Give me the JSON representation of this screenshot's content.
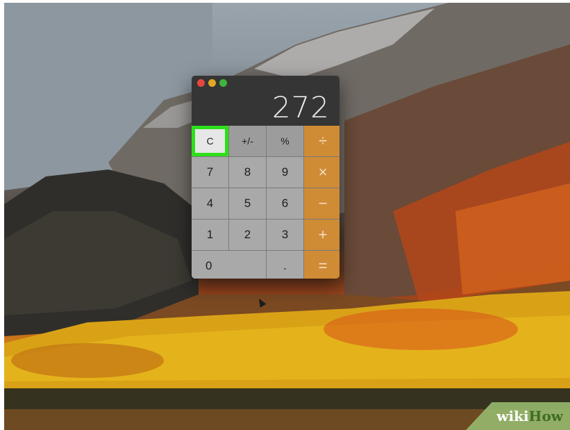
{
  "calculator": {
    "display_value": "272",
    "window_controls": [
      "close",
      "minimize",
      "zoom"
    ],
    "keys": [
      {
        "label": "C",
        "kind": "func",
        "selected": true
      },
      {
        "label": "+/-",
        "kind": "func"
      },
      {
        "label": "%",
        "kind": "func"
      },
      {
        "label": "÷",
        "kind": "op"
      },
      {
        "label": "7",
        "kind": "num"
      },
      {
        "label": "8",
        "kind": "num"
      },
      {
        "label": "9",
        "kind": "num"
      },
      {
        "label": "×",
        "kind": "op"
      },
      {
        "label": "4",
        "kind": "num"
      },
      {
        "label": "5",
        "kind": "num"
      },
      {
        "label": "6",
        "kind": "num"
      },
      {
        "label": "−",
        "kind": "op"
      },
      {
        "label": "1",
        "kind": "num"
      },
      {
        "label": "2",
        "kind": "num"
      },
      {
        "label": "3",
        "kind": "num"
      },
      {
        "label": "+",
        "kind": "op"
      },
      {
        "label": "0",
        "kind": "num"
      },
      {
        "label": ".",
        "kind": "num"
      },
      {
        "label": "=",
        "kind": "op"
      }
    ],
    "highlight_color": "#2ddf1a",
    "operator_color": "#d08b35"
  },
  "watermark": {
    "part1": "wiki",
    "part2": "How"
  }
}
